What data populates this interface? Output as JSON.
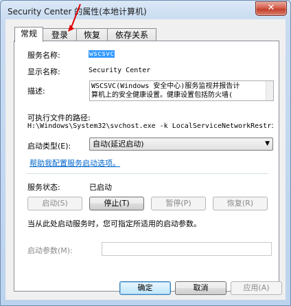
{
  "window": {
    "title": "Security Center 的属性(本地计算机)",
    "close_icon": "close-icon"
  },
  "tabs": [
    {
      "label": "常规"
    },
    {
      "label": "登录"
    },
    {
      "label": "恢复"
    },
    {
      "label": "依存关系"
    }
  ],
  "general": {
    "service_name_label": "服务名称:",
    "service_name_value": "wscsvc",
    "display_name_label": "显示名称:",
    "display_name_value": "Security Center",
    "description_label": "描述:",
    "description_line1": "WSCSVC(Windows 安全中心)服务监视并报告计",
    "description_line2": "算机上的安全健康设置。健康设置包括防火墙(",
    "path_label": "可执行文件的路径:",
    "path_value": "H:\\Windows\\System32\\svchost.exe -k LocalServiceNetworkRestri",
    "startup_type_label": "启动类型(E):",
    "startup_type_value": "自动(延迟启动)",
    "help_link": "帮助我配置服务启动选项。",
    "status_label": "服务状态:",
    "status_value": "已启动",
    "start_button": "启动(S)",
    "stop_button": "停止(T)",
    "pause_button": "暂停(P)",
    "resume_button": "恢复(R)",
    "hint_text": "当从此处启动服务时，您可指定所适用的启动参数。",
    "params_label": "启动参数(M):",
    "params_value": ""
  },
  "footer": {
    "ok_button": "确定",
    "cancel_button": "取消",
    "apply_button": "应用(A)"
  }
}
